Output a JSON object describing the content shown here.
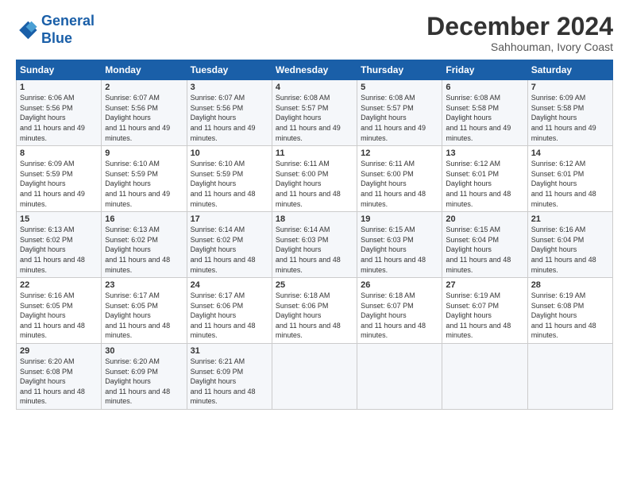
{
  "logo": {
    "line1": "General",
    "line2": "Blue"
  },
  "title": "December 2024",
  "subtitle": "Sahhouman, Ivory Coast",
  "days_header": [
    "Sunday",
    "Monday",
    "Tuesday",
    "Wednesday",
    "Thursday",
    "Friday",
    "Saturday"
  ],
  "weeks": [
    [
      {
        "day": "1",
        "rise": "6:06 AM",
        "set": "5:56 PM",
        "daylight": "11 hours and 49 minutes."
      },
      {
        "day": "2",
        "rise": "6:07 AM",
        "set": "5:56 PM",
        "daylight": "11 hours and 49 minutes."
      },
      {
        "day": "3",
        "rise": "6:07 AM",
        "set": "5:56 PM",
        "daylight": "11 hours and 49 minutes."
      },
      {
        "day": "4",
        "rise": "6:08 AM",
        "set": "5:57 PM",
        "daylight": "11 hours and 49 minutes."
      },
      {
        "day": "5",
        "rise": "6:08 AM",
        "set": "5:57 PM",
        "daylight": "11 hours and 49 minutes."
      },
      {
        "day": "6",
        "rise": "6:08 AM",
        "set": "5:58 PM",
        "daylight": "11 hours and 49 minutes."
      },
      {
        "day": "7",
        "rise": "6:09 AM",
        "set": "5:58 PM",
        "daylight": "11 hours and 49 minutes."
      }
    ],
    [
      {
        "day": "8",
        "rise": "6:09 AM",
        "set": "5:59 PM",
        "daylight": "11 hours and 49 minutes."
      },
      {
        "day": "9",
        "rise": "6:10 AM",
        "set": "5:59 PM",
        "daylight": "11 hours and 49 minutes."
      },
      {
        "day": "10",
        "rise": "6:10 AM",
        "set": "5:59 PM",
        "daylight": "11 hours and 48 minutes."
      },
      {
        "day": "11",
        "rise": "6:11 AM",
        "set": "6:00 PM",
        "daylight": "11 hours and 48 minutes."
      },
      {
        "day": "12",
        "rise": "6:11 AM",
        "set": "6:00 PM",
        "daylight": "11 hours and 48 minutes."
      },
      {
        "day": "13",
        "rise": "6:12 AM",
        "set": "6:01 PM",
        "daylight": "11 hours and 48 minutes."
      },
      {
        "day": "14",
        "rise": "6:12 AM",
        "set": "6:01 PM",
        "daylight": "11 hours and 48 minutes."
      }
    ],
    [
      {
        "day": "15",
        "rise": "6:13 AM",
        "set": "6:02 PM",
        "daylight": "11 hours and 48 minutes."
      },
      {
        "day": "16",
        "rise": "6:13 AM",
        "set": "6:02 PM",
        "daylight": "11 hours and 48 minutes."
      },
      {
        "day": "17",
        "rise": "6:14 AM",
        "set": "6:02 PM",
        "daylight": "11 hours and 48 minutes."
      },
      {
        "day": "18",
        "rise": "6:14 AM",
        "set": "6:03 PM",
        "daylight": "11 hours and 48 minutes."
      },
      {
        "day": "19",
        "rise": "6:15 AM",
        "set": "6:03 PM",
        "daylight": "11 hours and 48 minutes."
      },
      {
        "day": "20",
        "rise": "6:15 AM",
        "set": "6:04 PM",
        "daylight": "11 hours and 48 minutes."
      },
      {
        "day": "21",
        "rise": "6:16 AM",
        "set": "6:04 PM",
        "daylight": "11 hours and 48 minutes."
      }
    ],
    [
      {
        "day": "22",
        "rise": "6:16 AM",
        "set": "6:05 PM",
        "daylight": "11 hours and 48 minutes."
      },
      {
        "day": "23",
        "rise": "6:17 AM",
        "set": "6:05 PM",
        "daylight": "11 hours and 48 minutes."
      },
      {
        "day": "24",
        "rise": "6:17 AM",
        "set": "6:06 PM",
        "daylight": "11 hours and 48 minutes."
      },
      {
        "day": "25",
        "rise": "6:18 AM",
        "set": "6:06 PM",
        "daylight": "11 hours and 48 minutes."
      },
      {
        "day": "26",
        "rise": "6:18 AM",
        "set": "6:07 PM",
        "daylight": "11 hours and 48 minutes."
      },
      {
        "day": "27",
        "rise": "6:19 AM",
        "set": "6:07 PM",
        "daylight": "11 hours and 48 minutes."
      },
      {
        "day": "28",
        "rise": "6:19 AM",
        "set": "6:08 PM",
        "daylight": "11 hours and 48 minutes."
      }
    ],
    [
      {
        "day": "29",
        "rise": "6:20 AM",
        "set": "6:08 PM",
        "daylight": "11 hours and 48 minutes."
      },
      {
        "day": "30",
        "rise": "6:20 AM",
        "set": "6:09 PM",
        "daylight": "11 hours and 48 minutes."
      },
      {
        "day": "31",
        "rise": "6:21 AM",
        "set": "6:09 PM",
        "daylight": "11 hours and 48 minutes."
      },
      null,
      null,
      null,
      null
    ]
  ]
}
